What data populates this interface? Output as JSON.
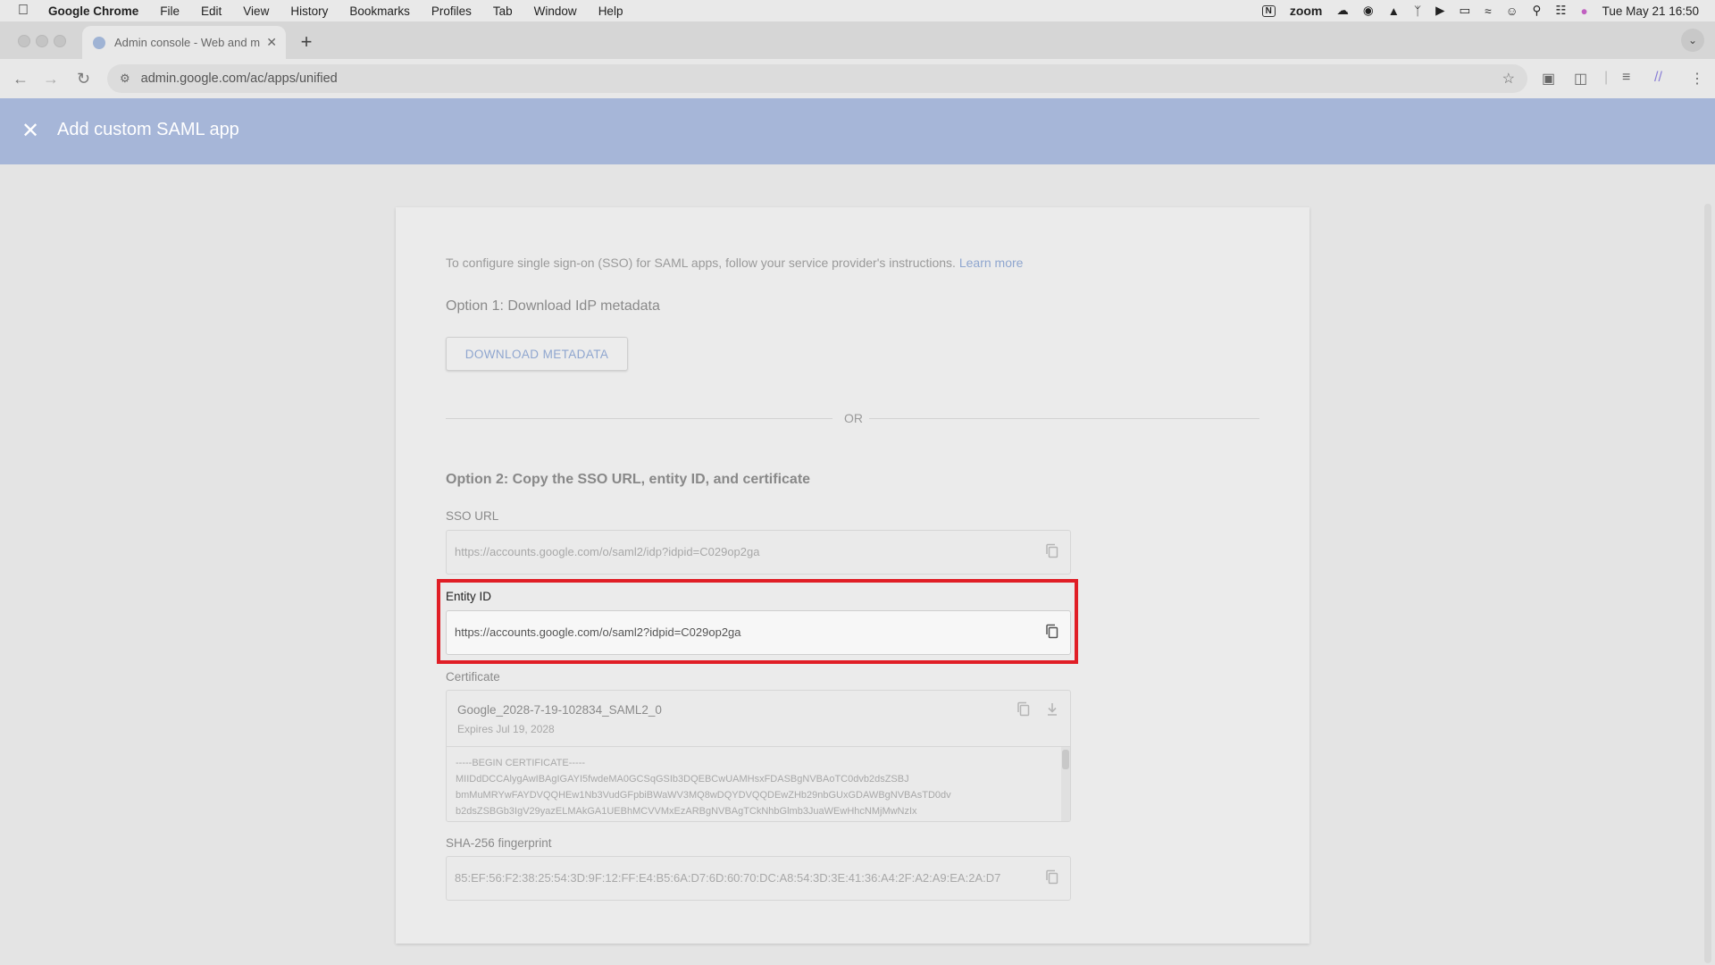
{
  "menubar": {
    "apple": "",
    "app": "Google Chrome",
    "items": [
      "File",
      "Edit",
      "View",
      "History",
      "Bookmarks",
      "Profiles",
      "Tab",
      "Window",
      "Help"
    ],
    "zoom": "zoom",
    "clock": "Tue May 21  16:50"
  },
  "browser": {
    "tab_title": "Admin console - Web and m",
    "url": "admin.google.com/ac/apps/unified"
  },
  "header": {
    "title": "Add custom SAML app"
  },
  "content": {
    "intro": "To configure single sign-on (SSO) for SAML apps, follow your service provider's instructions.",
    "learn_more": "Learn more",
    "option1_title": "Option 1: Download IdP metadata",
    "download_button": "DOWNLOAD METADATA",
    "or": "OR",
    "option2_title": "Option 2: Copy the SSO URL, entity ID, and certificate",
    "sso_label": "SSO URL",
    "sso_value": "https://accounts.google.com/o/saml2/idp?idpid=C029op2ga",
    "entity_label": "Entity ID",
    "entity_value": "https://accounts.google.com/o/saml2?idpid=C029op2ga",
    "cert_label": "Certificate",
    "cert_name": "Google_2028-7-19-102834_SAML2_0",
    "cert_expires": "Expires Jul 19, 2028",
    "cert_body": "-----BEGIN CERTIFICATE-----\nMIIDdDCCAlygAwIBAgIGAYI5fwdeMA0GCSqGSIb3DQEBCwUAMHsxFDASBgNVBAoTC0dvb2dsZSBJ\nbmMuMRYwFAYDVQQHEw1Nb3VudGFpbiBWaWV3MQ8wDQYDVQQDEwZHb29nbGUxGDAWBgNVBAsTD0dv\nb2dsZSBGb3IgV29yazELMAkGA1UEBhMCVVMxEzARBgNVBAgTCkNhbGlmb3JuaWEwHhcNMjMwNzIx",
    "sha_label": "SHA-256 fingerprint",
    "sha_value": "85:EF:56:F2:38:25:54:3D:9F:12:FF:E4:B5:6A:D7:6D:60:70:DC:A8:54:3D:3E:41:36:A4:2F:A2:A9:EA:2A:D7"
  }
}
